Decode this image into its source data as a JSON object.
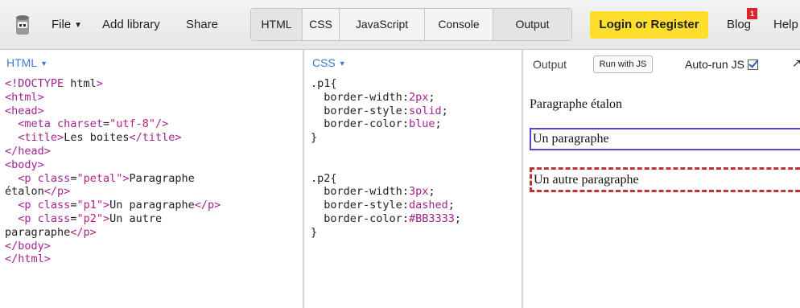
{
  "toolbar": {
    "file_label": "File",
    "add_library": "Add library",
    "share": "Share",
    "tabs": [
      "HTML",
      "CSS",
      "JavaScript",
      "Console",
      "Output"
    ],
    "login": "Login or Register",
    "blog": "Blog",
    "blog_badge": "1",
    "help": "Help"
  },
  "html_panel": {
    "label": "HTML",
    "code": [
      "<!DOCTYPE html>",
      "<html>",
      "<head>",
      "  <meta charset=\"utf-8\"/>",
      "  <title>Les boites</title>",
      "</head>",
      "<body>",
      "  <p class=\"petal\">Paragraphe",
      "étalon</p>",
      "  <p class=\"p1\">Un paragraphe</p>",
      "  <p class=\"p2\">Un autre",
      "paragraphe</p>",
      "</body>",
      "</html>"
    ]
  },
  "css_panel": {
    "label": "CSS",
    "code": [
      ".p1{",
      "  border-width:2px;",
      "  border-style:solid;",
      "  border-color:blue;",
      "}",
      "",
      "",
      ".p2{",
      "  border-width:3px;",
      "  border-style:dashed;",
      "  border-color:#BB3333;",
      "}"
    ]
  },
  "output_panel": {
    "label": "Output",
    "run_button": "Run with JS",
    "auto_run": "Auto-run JS",
    "auto_run_checked": true,
    "paragraphs": [
      "Paragraphe étalon",
      "Un paragraphe",
      "Un autre paragraphe"
    ]
  },
  "colors": {
    "login_bg": "#ffdf2b",
    "panel_label": "#3d7ad6",
    "p1_border": "#5b3fd6",
    "p2_border": "#bb3333"
  }
}
